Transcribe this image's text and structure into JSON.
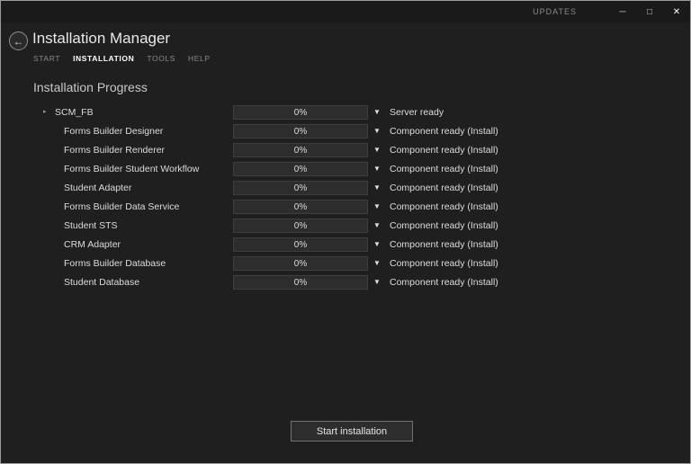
{
  "titlebar": {
    "updates_label": "UPDATES"
  },
  "icons": {
    "back": "←",
    "expand": "▸",
    "dropdown": "▼",
    "minimize": "─",
    "maximize": "□",
    "close": "✕"
  },
  "header": {
    "title": "Installation Manager",
    "nav": {
      "start": "START",
      "installation": "INSTALLATION",
      "tools": "TOOLS",
      "help": "HELP"
    }
  },
  "main": {
    "heading": "Installation Progress",
    "rows": [
      {
        "name": "SCM_FB",
        "progress": "0%",
        "status": "Server ready",
        "expandable": true,
        "indent": 0
      },
      {
        "name": "Forms Builder Designer",
        "progress": "0%",
        "status": "Component ready (Install)",
        "expandable": false,
        "indent": 1
      },
      {
        "name": "Forms Builder Renderer",
        "progress": "0%",
        "status": "Component ready (Install)",
        "expandable": false,
        "indent": 1
      },
      {
        "name": "Forms Builder Student Workflow",
        "progress": "0%",
        "status": "Component ready (Install)",
        "expandable": false,
        "indent": 1
      },
      {
        "name": "Student Adapter",
        "progress": "0%",
        "status": "Component ready (Install)",
        "expandable": false,
        "indent": 1
      },
      {
        "name": "Forms Builder Data Service",
        "progress": "0%",
        "status": "Component ready (Install)",
        "expandable": false,
        "indent": 1
      },
      {
        "name": "Student STS",
        "progress": "0%",
        "status": "Component ready (Install)",
        "expandable": false,
        "indent": 1
      },
      {
        "name": "CRM Adapter",
        "progress": "0%",
        "status": "Component ready (Install)",
        "expandable": false,
        "indent": 1
      },
      {
        "name": "Forms Builder Database",
        "progress": "0%",
        "status": "Component ready (Install)",
        "expandable": false,
        "indent": 1
      },
      {
        "name": "Student Database",
        "progress": "0%",
        "status": "Component ready (Install)",
        "expandable": false,
        "indent": 1
      }
    ],
    "start_button_label": "Start installation"
  }
}
